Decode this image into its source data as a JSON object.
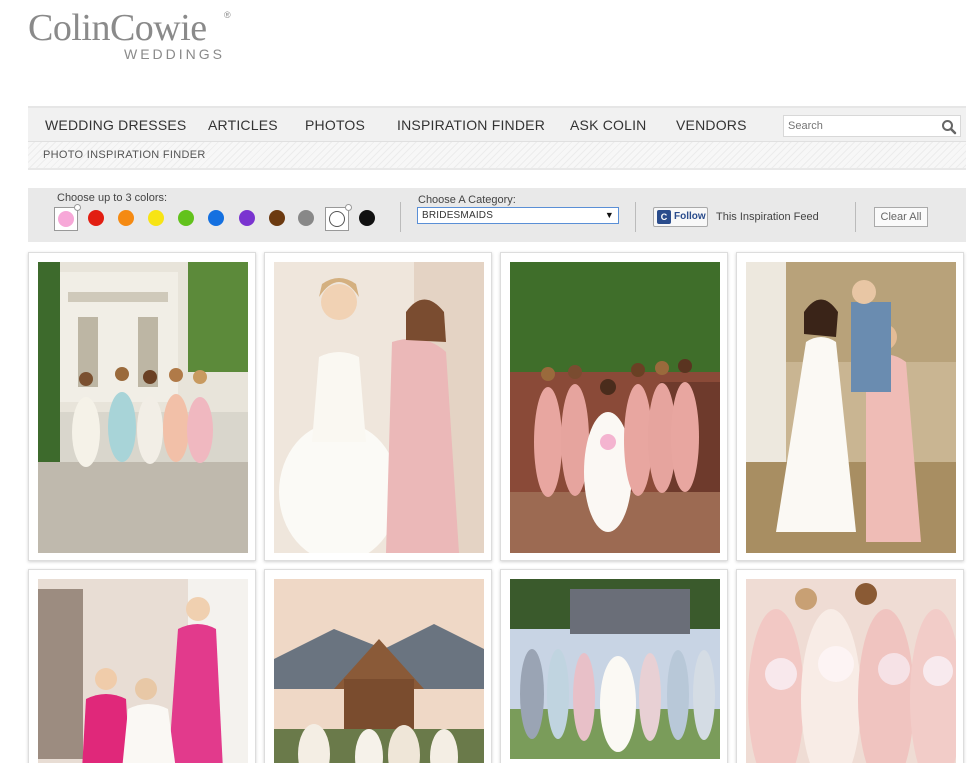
{
  "brand": {
    "name": "ColinCowie",
    "registered": "®",
    "tagline": "WEDDINGS"
  },
  "nav": {
    "items": [
      {
        "label": "WEDDING DRESSES"
      },
      {
        "label": "ARTICLES"
      },
      {
        "label": "PHOTOS"
      },
      {
        "label": "INSPIRATION FINDER"
      },
      {
        "label": "ASK COLIN"
      },
      {
        "label": "VENDORS"
      }
    ],
    "search": {
      "placeholder": "Search",
      "icon": "search-icon"
    }
  },
  "breadcrumb": "PHOTO INSPIRATION FINDER",
  "filters": {
    "colors_label": "Choose up to 3 colors:",
    "colors": [
      {
        "name": "pink",
        "hex": "#f7a8d8",
        "selected": true
      },
      {
        "name": "red",
        "hex": "#e21e12"
      },
      {
        "name": "orange",
        "hex": "#f58a12"
      },
      {
        "name": "yellow",
        "hex": "#f7e414"
      },
      {
        "name": "green",
        "hex": "#62c21c"
      },
      {
        "name": "blue",
        "hex": "#1470e0"
      },
      {
        "name": "purple",
        "hex": "#7a34d0"
      },
      {
        "name": "brown",
        "hex": "#6c3a10"
      },
      {
        "name": "gray",
        "hex": "#888888"
      },
      {
        "name": "white",
        "hex": "#ffffff",
        "boxed": true
      },
      {
        "name": "black",
        "hex": "#111111"
      }
    ],
    "category_label": "Choose A Category:",
    "category_value": "BRIDESMAIDS",
    "follow_label": "Follow",
    "feed_text": "This Inspiration Feed",
    "clear_label": "Clear All"
  },
  "photos": [
    {
      "subject": "bridesmaids-walking-pastel-dresses"
    },
    {
      "subject": "bride-with-bridesmaid-pink-gown"
    },
    {
      "subject": "bride-with-blush-bridesmaids-on-steps"
    },
    {
      "subject": "bridesmaid-helping-bride-dress"
    },
    {
      "subject": "bridesmaids-in-fuchsia-getting-ready"
    },
    {
      "subject": "bridal-party-at-barn-mountains"
    },
    {
      "subject": "bridesmaids-mixed-pastels-outdoors"
    },
    {
      "subject": "bridesmaids-blush-with-bouquets"
    }
  ]
}
